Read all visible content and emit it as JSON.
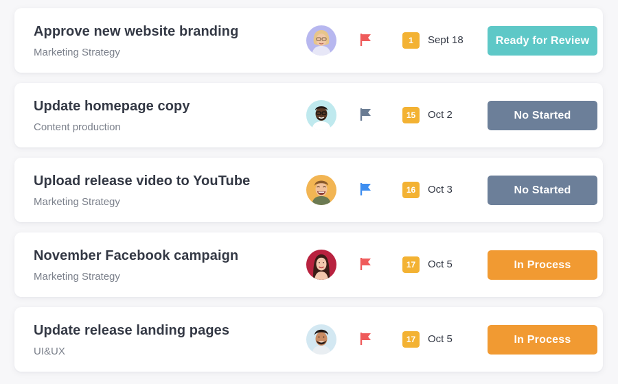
{
  "colors": {
    "ready": "#5ec8c7",
    "not_started": "#6c7f99",
    "in_process": "#f19a32",
    "date_badge": "#f3b233",
    "flag_red": "#ef5b5b",
    "flag_gray": "#6a7c93",
    "flag_blue": "#3e8ef0"
  },
  "tasks": [
    {
      "title": "Approve new website branding",
      "project": "Marketing Strategy",
      "avatar": "avatar-woman-glasses",
      "flag_color": "#ef5b5b",
      "day": "1",
      "date": "Sept 18",
      "status": "Ready for Review",
      "status_color": "#5ec8c7"
    },
    {
      "title": "Update homepage copy",
      "project": "Content production",
      "avatar": "avatar-man-beard",
      "flag_color": "#6a7c93",
      "day": "15",
      "date": "Oct 2",
      "status": "No Started",
      "status_color": "#6c7f99"
    },
    {
      "title": "Upload release video to YouTube",
      "project": "Marketing Strategy",
      "avatar": "avatar-man-laughing",
      "flag_color": "#3e8ef0",
      "day": "16",
      "date": "Oct 3",
      "status": "No Started",
      "status_color": "#6c7f99"
    },
    {
      "title": "November Facebook campaign",
      "project": "Marketing Strategy",
      "avatar": "avatar-woman-smiling",
      "flag_color": "#ef5b5b",
      "day": "17",
      "date": "Oct 5",
      "status": "In Process",
      "status_color": "#f19a32"
    },
    {
      "title": "Update release landing pages",
      "project": "UI&UX",
      "avatar": "avatar-man-smiling",
      "flag_color": "#ef5b5b",
      "day": "17",
      "date": "Oct 5",
      "status": "In Process",
      "status_color": "#f19a32"
    }
  ]
}
